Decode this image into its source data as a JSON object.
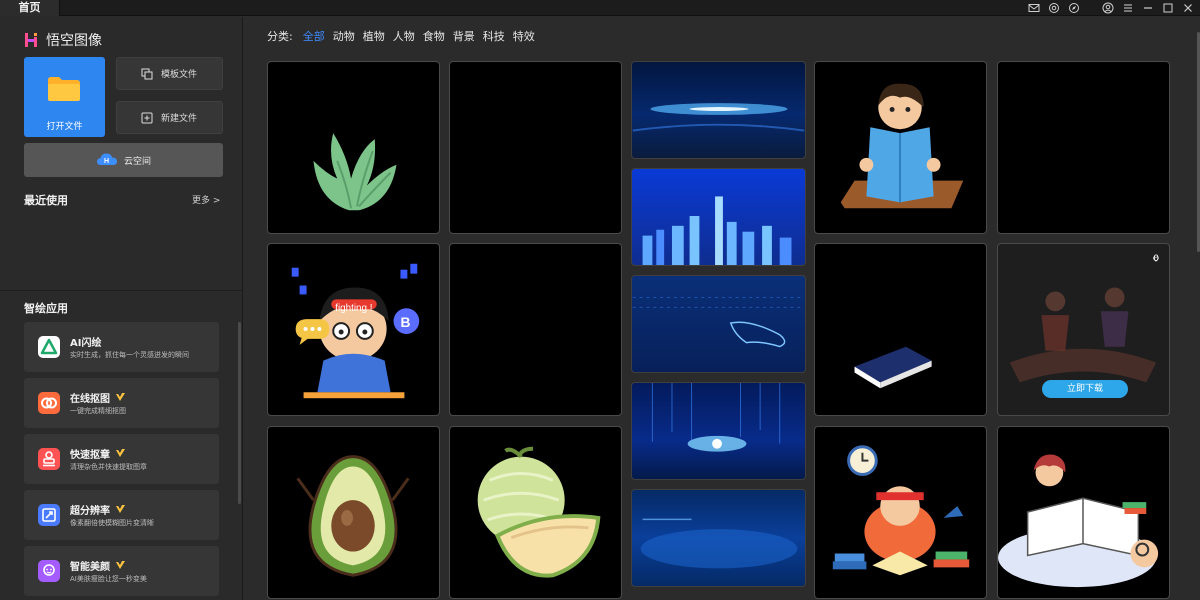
{
  "titlebar": {
    "home_tab": "首页",
    "icons": [
      "mail-icon",
      "target-icon",
      "compass-icon",
      "user-icon",
      "menu-icon",
      "minimize-icon",
      "maximize-icon",
      "close-icon"
    ]
  },
  "sidebar": {
    "app_name": "悟空图像",
    "open_file": "打开文件",
    "template_file": "模板文件",
    "new_file": "新建文件",
    "cloud_space": "云空间",
    "recent_title": "最近使用",
    "more": "更多 >",
    "apps_title": "智绘应用",
    "apps": [
      {
        "title": "AI闪绘",
        "desc": "实时生成，抓住每一个灵感迸发的瞬间",
        "color": "#ffffff",
        "vip": false
      },
      {
        "title": "在线抠图",
        "desc": "一键完成精细抠图",
        "color": "#ff7a45",
        "vip": true
      },
      {
        "title": "快速抠章",
        "desc": "清理杂色并快速提取图章",
        "color": "#ff5a5a",
        "vip": true
      },
      {
        "title": "超分辨率",
        "desc": "像素翻倍使模糊图片变清晰",
        "color": "#4a7bff",
        "vip": true
      },
      {
        "title": "智能美颜",
        "desc": "AI美肤瘦脸让您一秒变美",
        "color": "#a45cff",
        "vip": true
      }
    ]
  },
  "main": {
    "category_label": "分类:",
    "categories": [
      "全部",
      "动物",
      "植物",
      "人物",
      "食物",
      "背景",
      "科技",
      "特效"
    ],
    "active_category": "全部",
    "tiles": {
      "fighting_text": "fighting !",
      "like_count": "0",
      "download_button": "立即下载"
    }
  },
  "colors": {
    "accent": "#3f8cff",
    "open_file_bg": "#2e86f0",
    "download_bg": "#2ea7ea"
  }
}
